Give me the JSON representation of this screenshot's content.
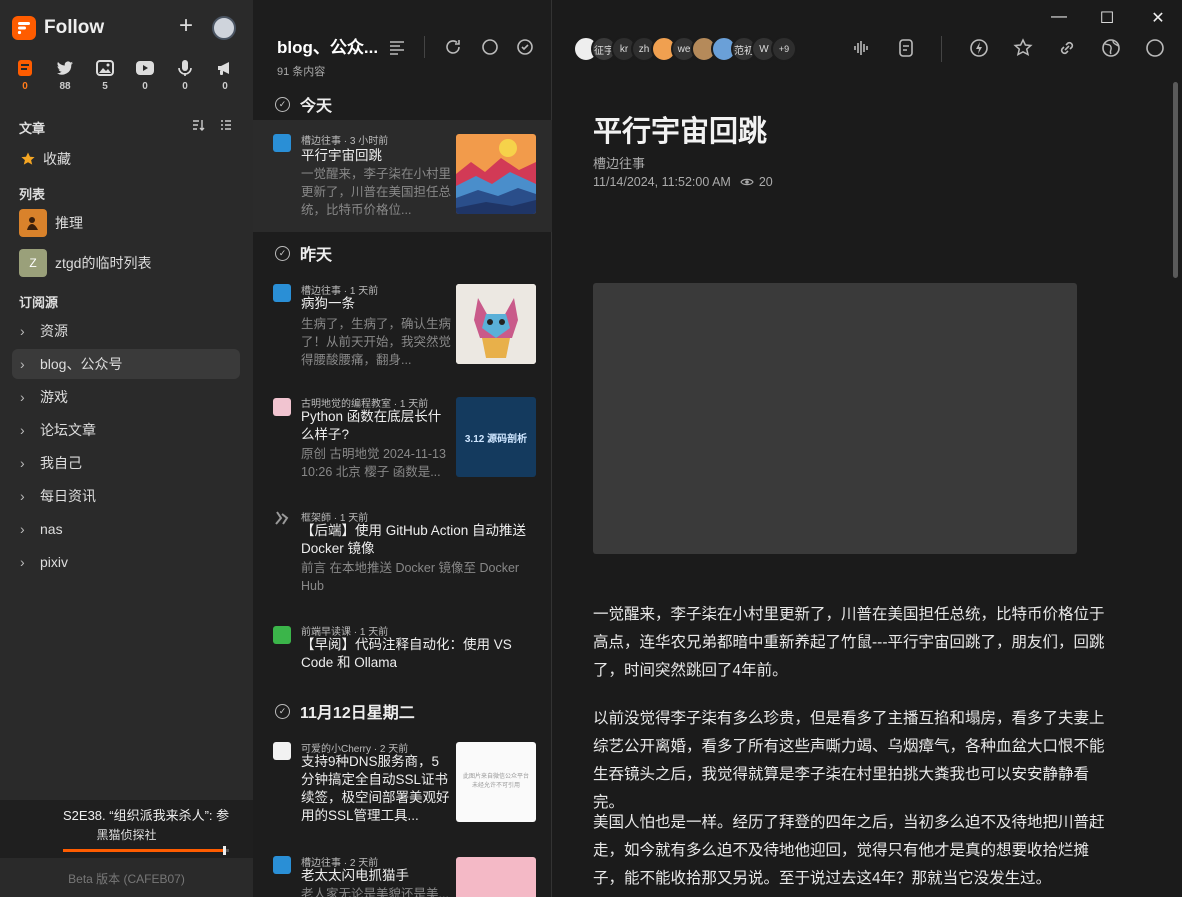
{
  "app": {
    "name": "Follow",
    "add_label": "+"
  },
  "types": [
    {
      "icon": "article-icon",
      "count": "0",
      "active": true
    },
    {
      "icon": "twitter-icon",
      "count": "88"
    },
    {
      "icon": "picture-icon",
      "count": "5"
    },
    {
      "icon": "video-icon",
      "count": "0"
    },
    {
      "icon": "microphone-icon",
      "count": "0"
    },
    {
      "icon": "megaphone-icon",
      "count": "0"
    }
  ],
  "sidebar": {
    "section_articles": "文章",
    "favorites": "收藏",
    "section_lists": "列表",
    "lists": [
      {
        "label": "推理",
        "thumb": ""
      },
      {
        "label": "ztgd的临时列表",
        "thumb": "Z"
      }
    ],
    "section_subscriptions": "订阅源",
    "folders": [
      "资源",
      "blog、公众号",
      "游戏",
      "论坛文章",
      "我自己",
      "每日资讯",
      "nas",
      "pixiv"
    ],
    "active_folder": "blog、公众号"
  },
  "player": {
    "title": "S2E38. “组织派我来杀人”: 参",
    "source": "黑猫侦探社",
    "progress": 0.98
  },
  "version": "Beta 版本 (CAFEB07)",
  "entry_column": {
    "name": "blog、公众...",
    "count": "91 条内容"
  },
  "days": [
    {
      "label": "今天"
    },
    {
      "label": "昨天"
    },
    {
      "label": "11月12日星期二"
    }
  ],
  "entries": [
    {
      "source": "槽边往事",
      "time": "3 小时前",
      "title": "平行宇宙回跳",
      "snippet": "一觉醒来，李子柒在小村里更新了，川普在美国担任总统，比特币价格位...",
      "thumb_text": ""
    },
    {
      "source": "槽边往事",
      "time": "1 天前",
      "title": "病狗一条",
      "snippet": "生病了，生病了，确认生病了！从前天开始，我突然觉得腰酸腰痛，翻身...",
      "thumb_text": ""
    },
    {
      "source": "古明地觉的编程教室",
      "time": "1 天前",
      "title": "Python 函数在底层长什么样子?",
      "snippet": "原创 古明地觉 2024-11-13 10:26 北京 樱子 函数是...",
      "thumb_text": "3.12 源码剖析"
    },
    {
      "source": "框架師",
      "time": "1 天前",
      "title": "【后端】使用 GitHub Action 自动推送 Docker 镜像",
      "snippet": "前言 在本地推送 Docker 镜像至 Docker Hub",
      "thumb_text": ""
    },
    {
      "source": "前端早读课",
      "time": "1 天前",
      "title": "【早阅】代码注释自动化：使用 VS Code 和 Ollama",
      "snippet": "",
      "thumb_text": ""
    },
    {
      "source": "可爱的小Cherry",
      "time": "2 天前",
      "title": "支持9种DNS服务商，5分钟搞定全自动SSL证书续签，极空间部署美观好用的SSL管理工具...",
      "snippet": "",
      "thumb_text": "此图片来自微信公众平台 未经允许不可引用"
    },
    {
      "source": "槽边往事",
      "time": "2 天前",
      "title": "老太太闪电抓猫手",
      "snippet": "老人家无论是美貌还是美...",
      "thumb_text": ""
    }
  ],
  "reader": {
    "window_controls": {
      "minimize": "—",
      "maximize": "☐",
      "close": "✕"
    },
    "avatars": [
      "",
      "征宇",
      "kr",
      "zh",
      "",
      "we",
      "",
      "",
      "范初",
      "W"
    ],
    "avatars_more": "+9",
    "title": "平行宇宙回跳",
    "author": "槽边往事",
    "date": "11/14/2024, 11:52:00 AM",
    "views": "20",
    "paragraphs": [
      "一觉醒来，李子柒在小村里更新了，川普在美国担任总统，比特币价格位于高点，连华农兄弟都暗中重新养起了竹鼠---平行宇宙回跳了，朋友们，回跳了，时间突然跳回了4年前。",
      "以前没觉得李子柒有多么珍贵，但是看多了主播互掐和塌房，看多了夫妻上综艺公开离婚，看多了所有这些声嘶力竭、乌烟瘴气，各种血盆大口恨不能生吞镜头之后，我觉得就算是李子柒在村里拍挑大粪我也可以安安静静看完。",
      "美国人怕也是一样。经历了拜登的四年之后，当初多么迫不及待地把川普赶走，如今就有多么迫不及待地他迎回，觉得只有他才是真的想要收拾烂摊子，能不能收拾那又另说。至于说过去这4年？那就当它没发生过。"
    ]
  },
  "colors": {
    "accent": "#ff5c00",
    "bg": "#1b1b1b",
    "sidebar": "#2a2a2a"
  }
}
